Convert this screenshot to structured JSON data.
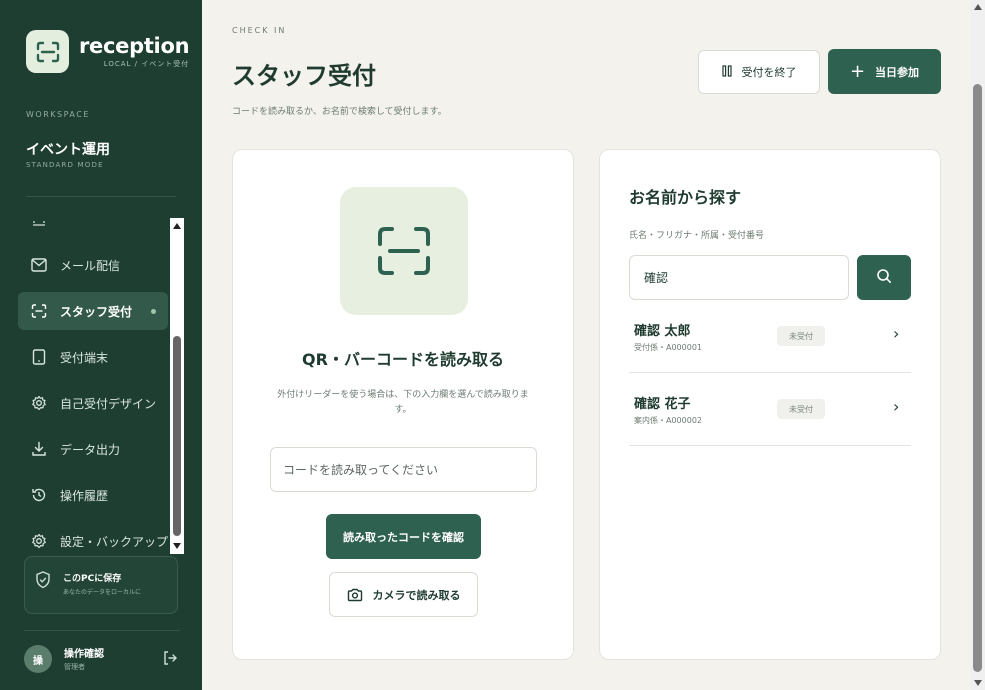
{
  "brand": {
    "name": "reception",
    "sub": "LOCAL / イベント受付"
  },
  "workspace": {
    "label": "WORKSPACE",
    "name": "イベント運用",
    "mode": "STANDARD MODE"
  },
  "nav": {
    "items": [
      {
        "label": "メール配信",
        "icon": "mail-icon"
      },
      {
        "label": "スタッフ受付",
        "icon": "scan-icon",
        "active": true
      },
      {
        "label": "受付端末",
        "icon": "tablet-icon"
      },
      {
        "label": "自己受付デザイン",
        "icon": "gear-icon"
      },
      {
        "label": "データ出力",
        "icon": "download-icon"
      },
      {
        "label": "操作履歴",
        "icon": "history-icon"
      },
      {
        "label": "設定・バックアップ",
        "icon": "gear-icon"
      }
    ]
  },
  "save_card": {
    "title": "このPCに保存",
    "sub": "あなたのデータをローカルに"
  },
  "user": {
    "initial": "操",
    "name": "操作確認",
    "role": "管理者"
  },
  "header": {
    "eyebrow": "CHECK IN",
    "title": "スタッフ受付",
    "description": "コードを読み取るか、お名前で検索して受付します。",
    "end_button": "受付を終了",
    "walkin_button": "当日参加"
  },
  "qr_card": {
    "title": "QR・バーコードを読み取る",
    "description": "外付けリーダーを使う場合は、下の入力欄を選んで読み取ります。",
    "input_placeholder": "コードを読み取ってください",
    "confirm_button": "読み取ったコードを確認",
    "camera_button": "カメラで読み取る"
  },
  "search_card": {
    "title": "お名前から探す",
    "hint": "氏名・フリガナ・所属・受付番号",
    "query": "確認",
    "results": [
      {
        "name": "確認 太郎",
        "sub": "受付係・A000001",
        "status": "未受付"
      },
      {
        "name": "確認 花子",
        "sub": "案内係・A000002",
        "status": "未受付"
      }
    ]
  },
  "colors": {
    "sidebar": "#1e3e32",
    "accent": "#2e6150",
    "background": "#f3f2ec"
  }
}
